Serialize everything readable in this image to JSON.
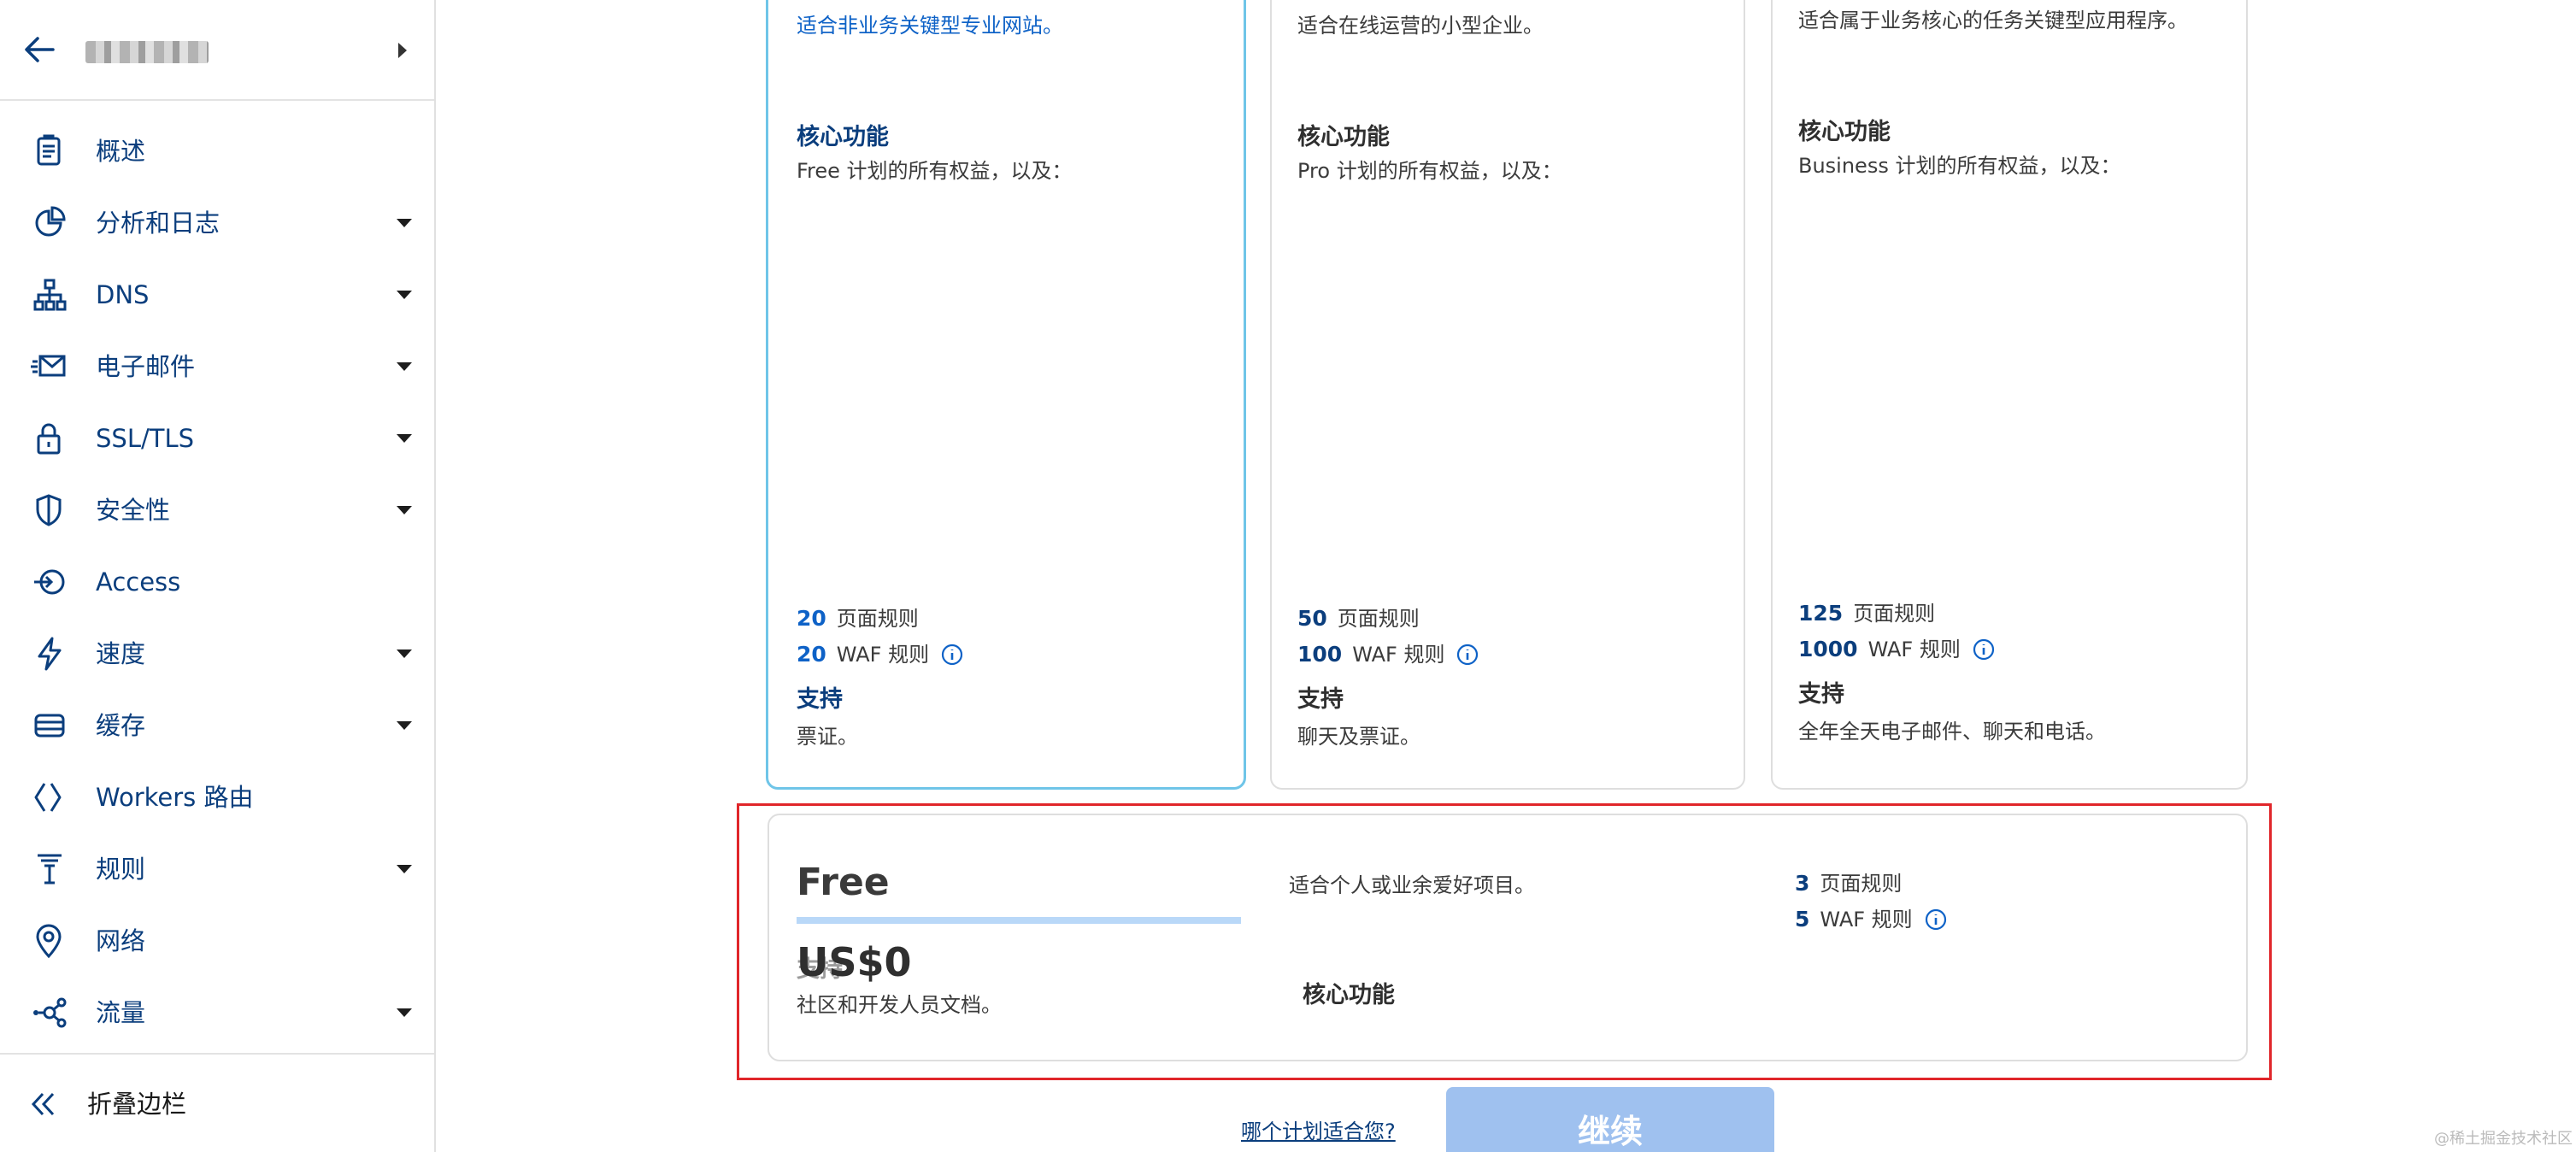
{
  "sidebar": {
    "account_label": "",
    "items": [
      {
        "label": "概述",
        "icon": "clipboard-icon",
        "has_caret": false
      },
      {
        "label": "分析和日志",
        "icon": "pie-chart-icon",
        "has_caret": true
      },
      {
        "label": "DNS",
        "icon": "sitemap-icon",
        "has_caret": true
      },
      {
        "label": "电子邮件",
        "icon": "envelope-icon",
        "has_caret": true
      },
      {
        "label": "SSL/TLS",
        "icon": "lock-icon",
        "has_caret": true
      },
      {
        "label": "安全性",
        "icon": "shield-icon",
        "has_caret": true
      },
      {
        "label": "Access",
        "icon": "access-icon",
        "has_caret": false
      },
      {
        "label": "速度",
        "icon": "lightning-icon",
        "has_caret": true
      },
      {
        "label": "缓存",
        "icon": "server-stack-icon",
        "has_caret": true
      },
      {
        "label": "Workers 路由",
        "icon": "workers-icon",
        "has_caret": false
      },
      {
        "label": "规则",
        "icon": "filter-funnel-icon",
        "has_caret": true
      },
      {
        "label": "网络",
        "icon": "location-pin-icon",
        "has_caret": false
      },
      {
        "label": "流量",
        "icon": "traffic-nodes-icon",
        "has_caret": true
      }
    ],
    "collapse_label": "折叠边栏"
  },
  "plans": {
    "pro": {
      "desc": "适合非业务关键型专业网站。",
      "core_heading": "核心功能",
      "core_sub": "Free 计划的所有权益，以及：",
      "page_rules_num": "20",
      "page_rules_label": "页面规则",
      "waf_rules_num": "20",
      "waf_rules_label": "WAF 规则",
      "support_heading": "支持",
      "support_text": "票证。"
    },
    "business": {
      "desc": "适合在线运营的小型企业。",
      "core_heading": "核心功能",
      "core_sub": "Pro 计划的所有权益，以及：",
      "page_rules_num": "50",
      "page_rules_label": "页面规则",
      "waf_rules_num": "100",
      "waf_rules_label": "WAF 规则",
      "support_heading": "支持",
      "support_text": "聊天及票证。"
    },
    "enterprise": {
      "desc": "适合属于业务核心的任务关键型应用程序。",
      "core_heading": "核心功能",
      "core_sub": "Business 计划的所有权益，以及：",
      "page_rules_num": "125",
      "page_rules_label": "页面规则",
      "waf_rules_num": "1000",
      "waf_rules_label": "WAF 规则",
      "support_heading": "支持",
      "support_text": "全年全天电子邮件、聊天和电话。"
    },
    "free": {
      "title": "Free",
      "price": "US$0",
      "support_heading": "支持",
      "support_text": "社区和开发人员文档。",
      "desc": "适合个人或业余爱好项目。",
      "core_heading": "核心功能",
      "page_rules_num": "3",
      "page_rules_label": "页面规则",
      "waf_rules_num": "5",
      "waf_rules_label": "WAF 规则"
    }
  },
  "footer": {
    "which_plan_link": "哪个计划适合您?",
    "continue_button": "继续"
  },
  "watermark": "@稀土掘金技术社区",
  "colors": {
    "nav_text": "#0b3e7d",
    "link_blue": "#0e62c7",
    "selected_border": "#6fc5e8",
    "highlight_red": "#e0262a",
    "button_disabled": "#9fc1ef"
  }
}
